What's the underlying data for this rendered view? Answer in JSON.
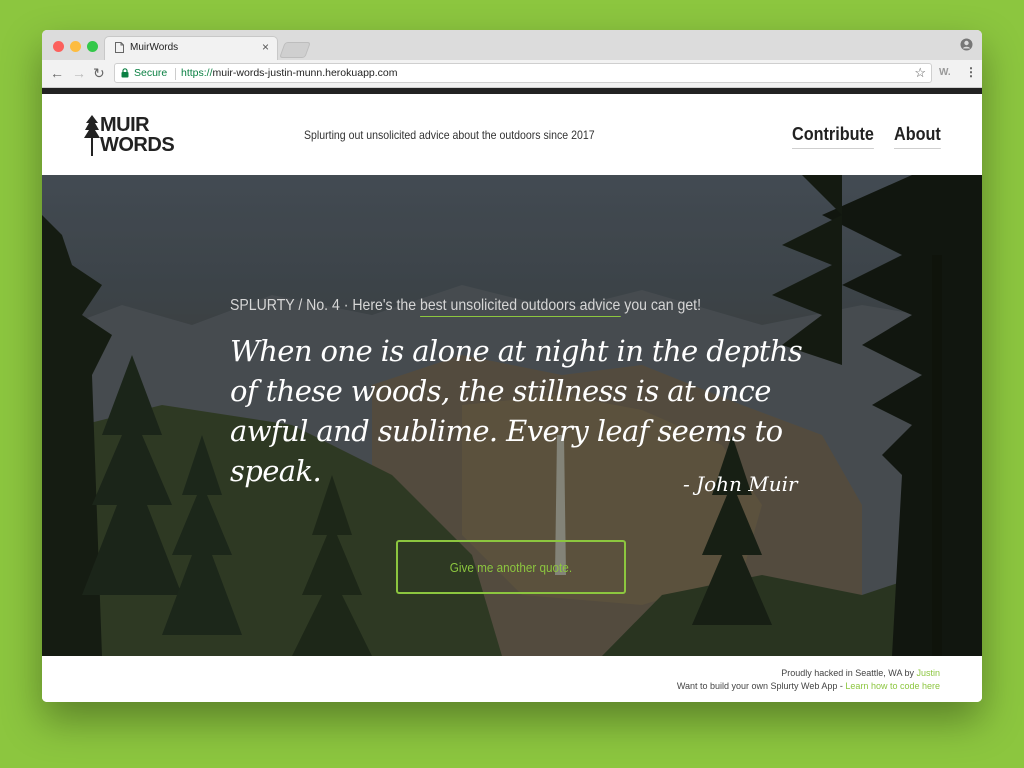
{
  "browser": {
    "tab_title": "MuirWords",
    "tab_close": "×",
    "secure_label": "Secure",
    "url_scheme": "https://",
    "url_rest": "muir-words-justin-munn.herokuapp.com",
    "extension_label": "W.",
    "menu_glyph": "⋮",
    "star_glyph": "☆",
    "back_glyph": "←",
    "forward_glyph": "→",
    "reload_glyph": "↻"
  },
  "header": {
    "logo_line1": "MUIR",
    "logo_line2": "WORDS",
    "tagline": "Splurting out unsolicited advice about the outdoors since 2017",
    "nav": {
      "contribute": "Contribute",
      "about": "About"
    }
  },
  "hero": {
    "kicker_prefix": "SPLURTY / No. 4 · Here's the ",
    "kicker_highlight": "best unsolicited outdoors advice",
    "kicker_suffix": " you can get!",
    "quote": "When one is alone at night in the depths of these woods, the stillness is at once awful and sublime. Every leaf seems to speak.",
    "author": "- John Muir",
    "button_label": "Give me another quote."
  },
  "footer": {
    "line1_text": "Proudly hacked in Seattle, WA by ",
    "line1_link": "Justin",
    "line2_text": "Want to build your own Splurty Web App - ",
    "line2_link": "Learn how to code here"
  },
  "colors": {
    "desktop_background": "#8cc63f",
    "accent_green": "#8cc63f",
    "secure_green": "#0b8043",
    "top_bar": "#222222"
  }
}
